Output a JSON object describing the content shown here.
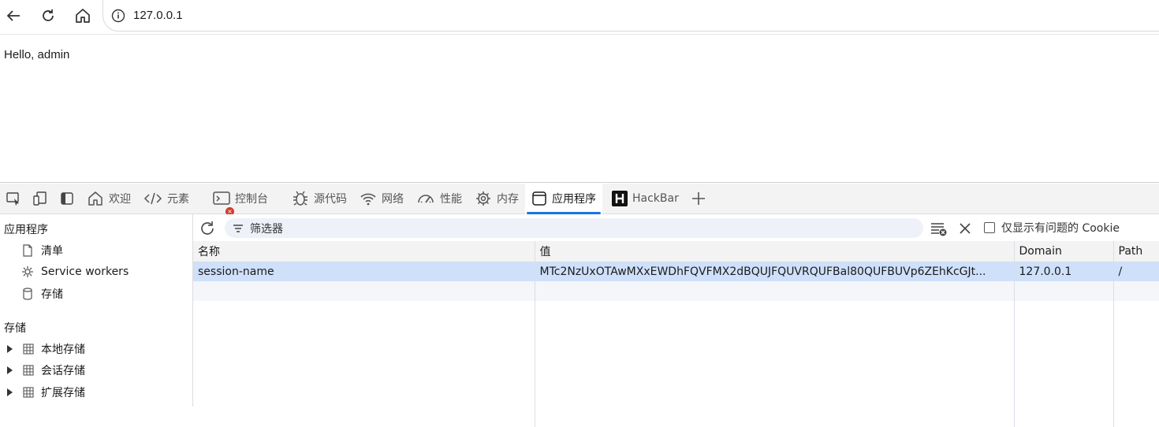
{
  "browser": {
    "address": "127.0.0.1"
  },
  "page": {
    "text": "Hello, admin"
  },
  "devtools": {
    "tabs": [
      {
        "label": "欢迎",
        "icon": "home-icon"
      },
      {
        "label": "元素",
        "icon": "code-icon"
      },
      {
        "label": "控制台",
        "icon": "console-icon"
      },
      {
        "label": "源代码",
        "icon": "bug-icon"
      },
      {
        "label": "网络",
        "icon": "wifi-icon"
      },
      {
        "label": "性能",
        "icon": "gauge-icon"
      },
      {
        "label": "内存",
        "icon": "chip-icon"
      },
      {
        "label": "应用程序",
        "icon": "app-window-icon",
        "active": true
      },
      {
        "label": "HackBar",
        "icon": "hackbar-icon"
      }
    ],
    "console_error_badge": "×"
  },
  "sidebar": {
    "app_heading": "应用程序",
    "app_items": [
      "清单",
      "Service workers",
      "存储"
    ],
    "storage_heading": "存储",
    "storage_items": [
      "本地存储",
      "会话存储",
      "扩展存储"
    ]
  },
  "cookies": {
    "filter_placeholder": "筛选器",
    "only_issues_label": "仅显示有问题的 Cookie",
    "only_issues_checked": false,
    "columns": [
      "名称",
      "值",
      "Domain",
      "Path"
    ],
    "rows": [
      {
        "name": "session-name",
        "value": "MTc2NzUxOTAwMXxEWDhFQVFMX2dBQUJFQUVRQUFBal80QUFBUVp6ZEhKcGJt...",
        "domain": "127.0.0.1",
        "path": "/"
      }
    ]
  },
  "colors": {
    "accent": "#1a73e8",
    "selected_row": "#cfe0fb",
    "error_badge": "#d23c2c"
  }
}
